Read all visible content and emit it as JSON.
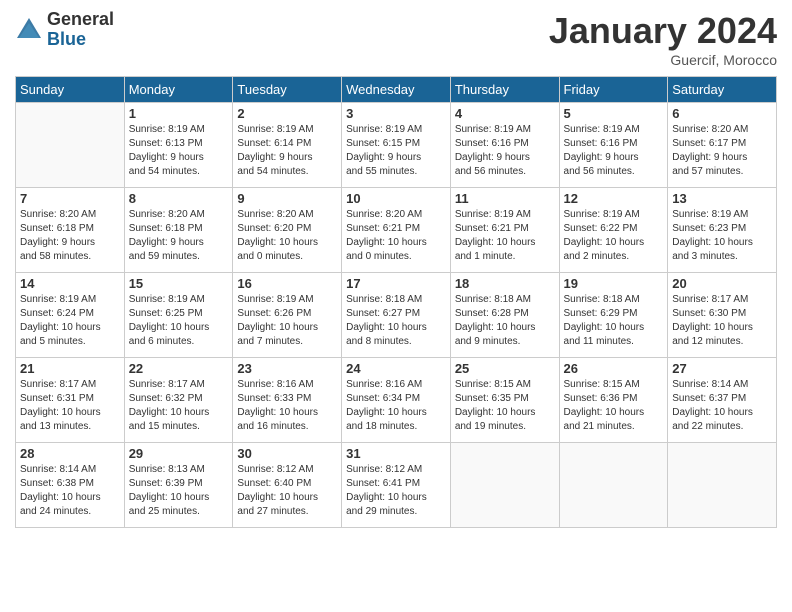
{
  "header": {
    "logo_general": "General",
    "logo_blue": "Blue",
    "month_title": "January 2024",
    "location": "Guercif, Morocco"
  },
  "days_of_week": [
    "Sunday",
    "Monday",
    "Tuesday",
    "Wednesday",
    "Thursday",
    "Friday",
    "Saturday"
  ],
  "weeks": [
    [
      {
        "day": "",
        "info": ""
      },
      {
        "day": "1",
        "info": "Sunrise: 8:19 AM\nSunset: 6:13 PM\nDaylight: 9 hours\nand 54 minutes."
      },
      {
        "day": "2",
        "info": "Sunrise: 8:19 AM\nSunset: 6:14 PM\nDaylight: 9 hours\nand 54 minutes."
      },
      {
        "day": "3",
        "info": "Sunrise: 8:19 AM\nSunset: 6:15 PM\nDaylight: 9 hours\nand 55 minutes."
      },
      {
        "day": "4",
        "info": "Sunrise: 8:19 AM\nSunset: 6:16 PM\nDaylight: 9 hours\nand 56 minutes."
      },
      {
        "day": "5",
        "info": "Sunrise: 8:19 AM\nSunset: 6:16 PM\nDaylight: 9 hours\nand 56 minutes."
      },
      {
        "day": "6",
        "info": "Sunrise: 8:20 AM\nSunset: 6:17 PM\nDaylight: 9 hours\nand 57 minutes."
      }
    ],
    [
      {
        "day": "7",
        "info": "Sunrise: 8:20 AM\nSunset: 6:18 PM\nDaylight: 9 hours\nand 58 minutes."
      },
      {
        "day": "8",
        "info": "Sunrise: 8:20 AM\nSunset: 6:18 PM\nDaylight: 9 hours\nand 59 minutes."
      },
      {
        "day": "9",
        "info": "Sunrise: 8:20 AM\nSunset: 6:20 PM\nDaylight: 10 hours\nand 0 minutes."
      },
      {
        "day": "10",
        "info": "Sunrise: 8:20 AM\nSunset: 6:21 PM\nDaylight: 10 hours\nand 0 minutes."
      },
      {
        "day": "11",
        "info": "Sunrise: 8:19 AM\nSunset: 6:21 PM\nDaylight: 10 hours\nand 1 minute."
      },
      {
        "day": "12",
        "info": "Sunrise: 8:19 AM\nSunset: 6:22 PM\nDaylight: 10 hours\nand 2 minutes."
      },
      {
        "day": "13",
        "info": "Sunrise: 8:19 AM\nSunset: 6:23 PM\nDaylight: 10 hours\nand 3 minutes."
      }
    ],
    [
      {
        "day": "14",
        "info": "Sunrise: 8:19 AM\nSunset: 6:24 PM\nDaylight: 10 hours\nand 5 minutes."
      },
      {
        "day": "15",
        "info": "Sunrise: 8:19 AM\nSunset: 6:25 PM\nDaylight: 10 hours\nand 6 minutes."
      },
      {
        "day": "16",
        "info": "Sunrise: 8:19 AM\nSunset: 6:26 PM\nDaylight: 10 hours\nand 7 minutes."
      },
      {
        "day": "17",
        "info": "Sunrise: 8:18 AM\nSunset: 6:27 PM\nDaylight: 10 hours\nand 8 minutes."
      },
      {
        "day": "18",
        "info": "Sunrise: 8:18 AM\nSunset: 6:28 PM\nDaylight: 10 hours\nand 9 minutes."
      },
      {
        "day": "19",
        "info": "Sunrise: 8:18 AM\nSunset: 6:29 PM\nDaylight: 10 hours\nand 11 minutes."
      },
      {
        "day": "20",
        "info": "Sunrise: 8:17 AM\nSunset: 6:30 PM\nDaylight: 10 hours\nand 12 minutes."
      }
    ],
    [
      {
        "day": "21",
        "info": "Sunrise: 8:17 AM\nSunset: 6:31 PM\nDaylight: 10 hours\nand 13 minutes."
      },
      {
        "day": "22",
        "info": "Sunrise: 8:17 AM\nSunset: 6:32 PM\nDaylight: 10 hours\nand 15 minutes."
      },
      {
        "day": "23",
        "info": "Sunrise: 8:16 AM\nSunset: 6:33 PM\nDaylight: 10 hours\nand 16 minutes."
      },
      {
        "day": "24",
        "info": "Sunrise: 8:16 AM\nSunset: 6:34 PM\nDaylight: 10 hours\nand 18 minutes."
      },
      {
        "day": "25",
        "info": "Sunrise: 8:15 AM\nSunset: 6:35 PM\nDaylight: 10 hours\nand 19 minutes."
      },
      {
        "day": "26",
        "info": "Sunrise: 8:15 AM\nSunset: 6:36 PM\nDaylight: 10 hours\nand 21 minutes."
      },
      {
        "day": "27",
        "info": "Sunrise: 8:14 AM\nSunset: 6:37 PM\nDaylight: 10 hours\nand 22 minutes."
      }
    ],
    [
      {
        "day": "28",
        "info": "Sunrise: 8:14 AM\nSunset: 6:38 PM\nDaylight: 10 hours\nand 24 minutes."
      },
      {
        "day": "29",
        "info": "Sunrise: 8:13 AM\nSunset: 6:39 PM\nDaylight: 10 hours\nand 25 minutes."
      },
      {
        "day": "30",
        "info": "Sunrise: 8:12 AM\nSunset: 6:40 PM\nDaylight: 10 hours\nand 27 minutes."
      },
      {
        "day": "31",
        "info": "Sunrise: 8:12 AM\nSunset: 6:41 PM\nDaylight: 10 hours\nand 29 minutes."
      },
      {
        "day": "",
        "info": ""
      },
      {
        "day": "",
        "info": ""
      },
      {
        "day": "",
        "info": ""
      }
    ]
  ]
}
